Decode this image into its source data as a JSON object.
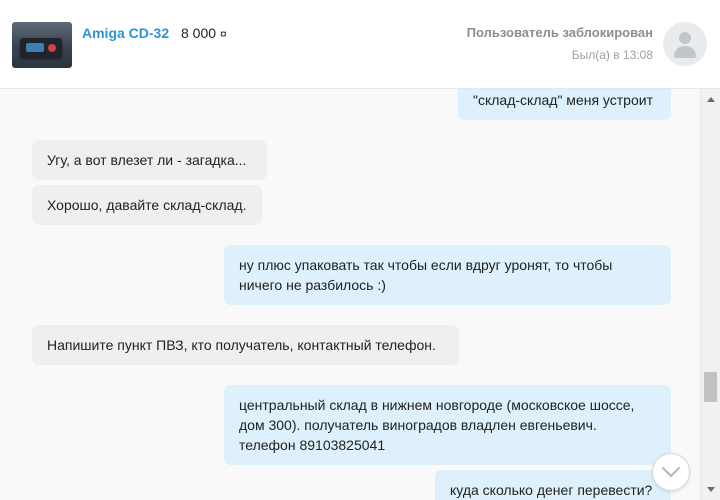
{
  "header": {
    "product_title": "Amiga CD-32",
    "price": "8 000",
    "currency_symbol": "¤",
    "user_status": "Пользователь заблокирован",
    "last_seen": "Был(а) в 13:08"
  },
  "messages": [
    {
      "direction": "out",
      "text": "\"склад-склад\" меня устроит"
    },
    {
      "direction": "in",
      "text": "Угу, а вот влезет ли - загадка..."
    },
    {
      "direction": "in",
      "text": "Хорошо, давайте склад-склад."
    },
    {
      "direction": "out",
      "text": "ну плюс упаковать так чтобы если вдруг уронят, то чтобы ничего не разбилось :)"
    },
    {
      "direction": "in",
      "text": "Напишите пункт ПВЗ, кто получатель, контактный телефон."
    },
    {
      "direction": "out",
      "text": "центральный склад в нижнем новгороде (московское шоссе, дом 300). получатель виноградов владлен евгеньевич. телефон 89103825041"
    },
    {
      "direction": "out",
      "text": "куда сколько денег перевести?"
    }
  ],
  "icons": {
    "avatar": "user-placeholder-icon",
    "scroll_down": "chevron-down-icon"
  },
  "colors": {
    "accent": "#2a95d4",
    "outgoing_bubble": "#ddf0fb",
    "incoming_bubble": "#efefef"
  }
}
